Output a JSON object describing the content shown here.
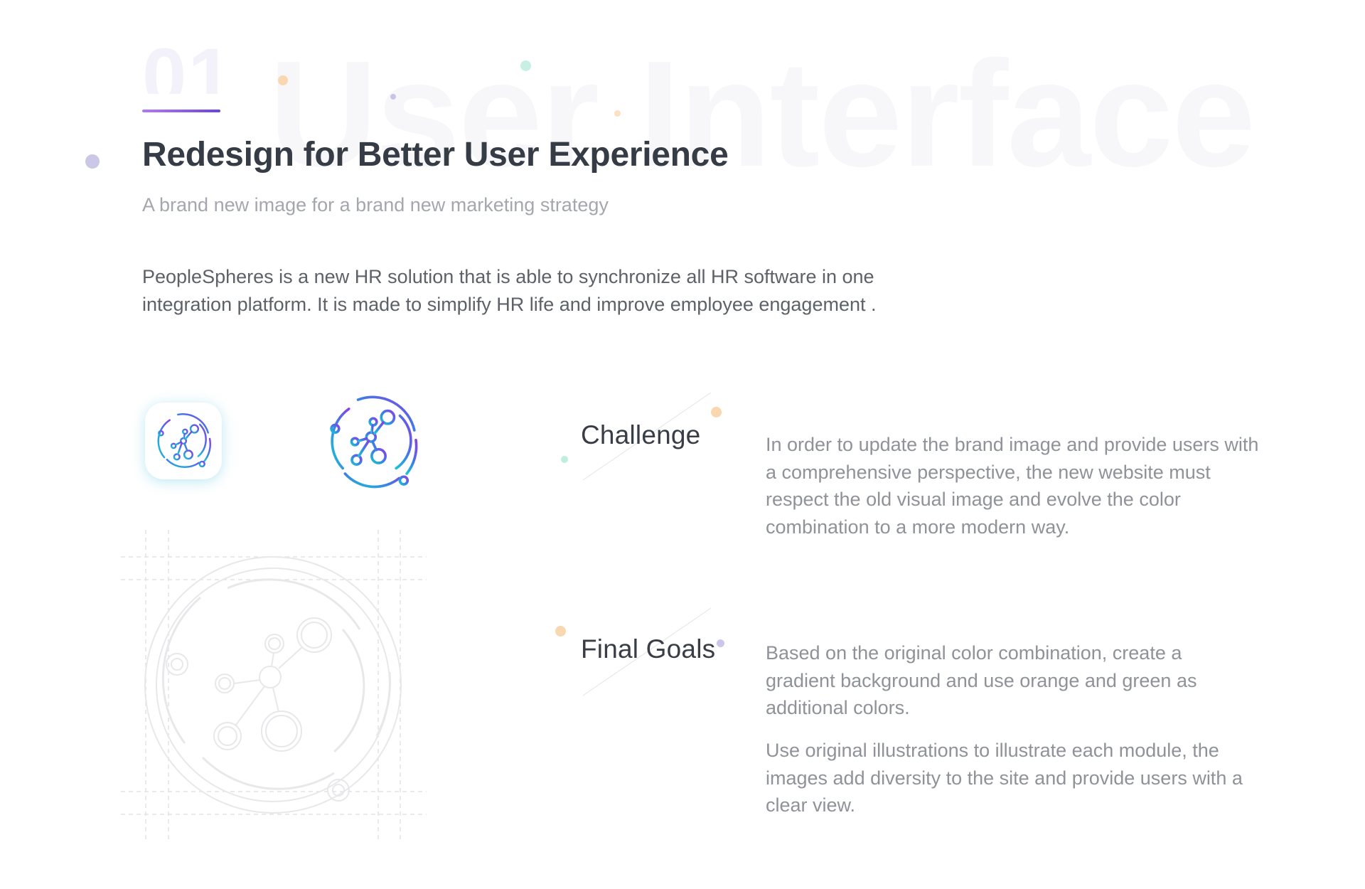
{
  "header": {
    "number": "01",
    "background_word": "User Interface",
    "title": "Redesign for Better User Experience",
    "subtitle": "A brand new image for a brand new marketing strategy",
    "intro": "PeopleSpheres is a new HR solution that is able to synchronize all HR software in one integration platform. It is made to simplify HR life and improve employee engagement ."
  },
  "logo": {
    "icon_name": "network-nodes-icon",
    "gradient_colors": [
      "#17c6d4",
      "#3d7ee6",
      "#8a3fe4"
    ]
  },
  "sections": [
    {
      "heading": "Challenge",
      "paragraphs": [
        "In order to update the brand image and provide users with a comprehensive perspective, the new website must respect the old visual image and evolve the color combination to a more modern way."
      ]
    },
    {
      "heading": "Final Goals",
      "paragraphs": [
        "Based on the original color combination, create a gradient background and use orange and green as additional colors.",
        "Use original illustrations to illustrate each module, the images add diversity to the site and provide users with a clear view."
      ]
    }
  ],
  "colors": {
    "heading": "#363c45",
    "body": "#8f9298",
    "accent_purple": "#6a48c9",
    "accent_orange": "#f6c58f",
    "accent_green": "#8fe0cd",
    "accent_lavender": "#b8b2e0"
  }
}
